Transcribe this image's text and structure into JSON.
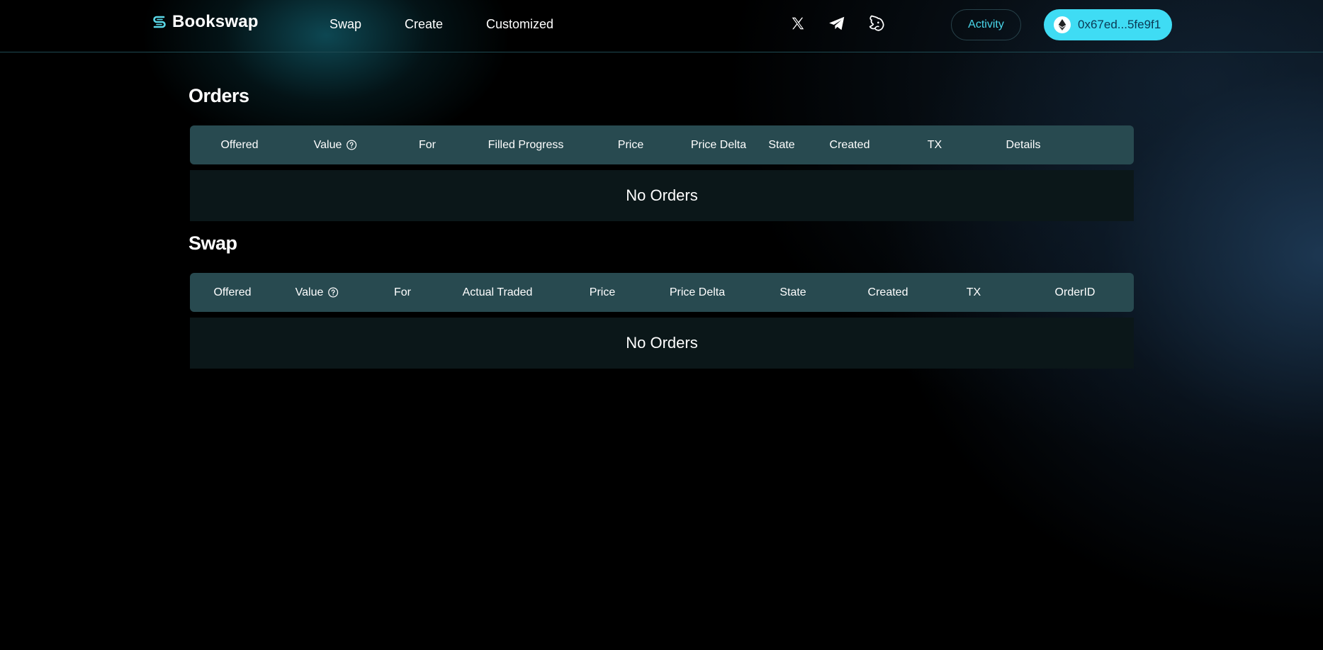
{
  "header": {
    "logo_text": "Bookswap",
    "nav": [
      {
        "label": "Swap"
      },
      {
        "label": "Create"
      },
      {
        "label": "Customized"
      }
    ],
    "social_icons": [
      "x-twitter-icon",
      "telegram-icon",
      "unicorn-icon"
    ],
    "activity_label": "Activity",
    "wallet_address": "0x67ed...5fe9f1",
    "wallet_icon": "ethereum-icon"
  },
  "orders": {
    "title": "Orders",
    "columns": [
      "Offered",
      "Value",
      "For",
      "Filled Progress",
      "Price",
      "Price Delta",
      "State",
      "Created",
      "TX",
      "Details"
    ],
    "empty_text": "No Orders"
  },
  "swap": {
    "title": "Swap",
    "columns": [
      "Offered",
      "Value",
      "For",
      "Actual Traded",
      "Price",
      "Price Delta",
      "State",
      "Created",
      "TX",
      "OrderID"
    ],
    "empty_text": "No Orders"
  },
  "colors": {
    "accent": "#3fdcf4",
    "activity_text": "#49d6ea",
    "table_header_bg": "#284a50",
    "table_body_bg": "#0b1719"
  }
}
